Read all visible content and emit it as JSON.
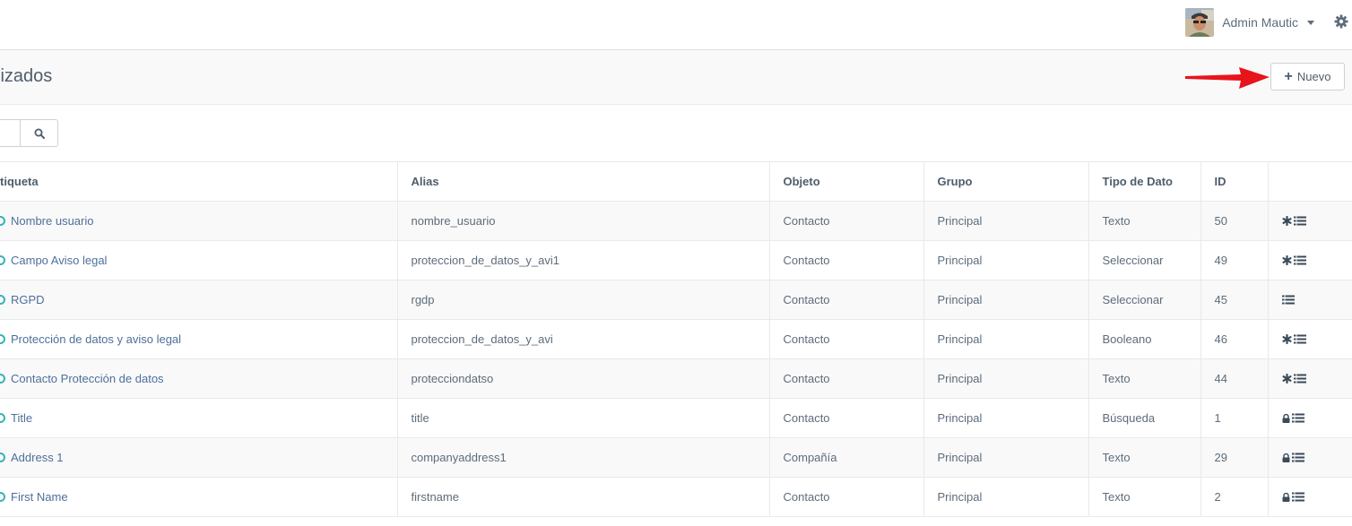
{
  "header": {
    "user_name": "Admin Mautic",
    "user_icon": "avatar-image",
    "settings_icon": "gear-icon"
  },
  "page": {
    "title": "lizados",
    "new_button_label": "Nuevo"
  },
  "search": {
    "placeholder": "",
    "button_icon": "search-icon"
  },
  "table": {
    "headers": {
      "label": "tiqueta",
      "alias": "Alias",
      "object": "Objeto",
      "group": "Grupo",
      "type": "Tipo de Dato",
      "id": "ID"
    },
    "rows": [
      {
        "label": "Nombre usuario",
        "alias": "nombre_usuario",
        "object": "Contacto",
        "group": "Principal",
        "type": "Texto",
        "id": "50",
        "required": true,
        "locked": false
      },
      {
        "label": "Campo Aviso legal",
        "alias": "proteccion_de_datos_y_avi1",
        "object": "Contacto",
        "group": "Principal",
        "type": "Seleccionar",
        "id": "49",
        "required": true,
        "locked": false
      },
      {
        "label": "RGPD",
        "alias": "rgdp",
        "object": "Contacto",
        "group": "Principal",
        "type": "Seleccionar",
        "id": "45",
        "required": false,
        "locked": false
      },
      {
        "label": "Protección de datos y aviso legal",
        "alias": "proteccion_de_datos_y_avi",
        "object": "Contacto",
        "group": "Principal",
        "type": "Booleano",
        "id": "46",
        "required": true,
        "locked": false
      },
      {
        "label": "Contacto Protección de datos",
        "alias": "protecciondatso",
        "object": "Contacto",
        "group": "Principal",
        "type": "Texto",
        "id": "44",
        "required": true,
        "locked": false
      },
      {
        "label": "Title",
        "alias": "title",
        "object": "Contacto",
        "group": "Principal",
        "type": "Búsqueda",
        "id": "1",
        "required": false,
        "locked": true
      },
      {
        "label": "Address 1",
        "alias": "companyaddress1",
        "object": "Compañía",
        "group": "Principal",
        "type": "Texto",
        "id": "29",
        "required": false,
        "locked": true
      },
      {
        "label": "First Name",
        "alias": "firstname",
        "object": "Contacto",
        "group": "Principal",
        "type": "Texto",
        "id": "2",
        "required": false,
        "locked": true
      }
    ]
  },
  "colors": {
    "toggle": "#35b4b9",
    "link": "#4e6f9a",
    "arrow": "#e8141b"
  }
}
